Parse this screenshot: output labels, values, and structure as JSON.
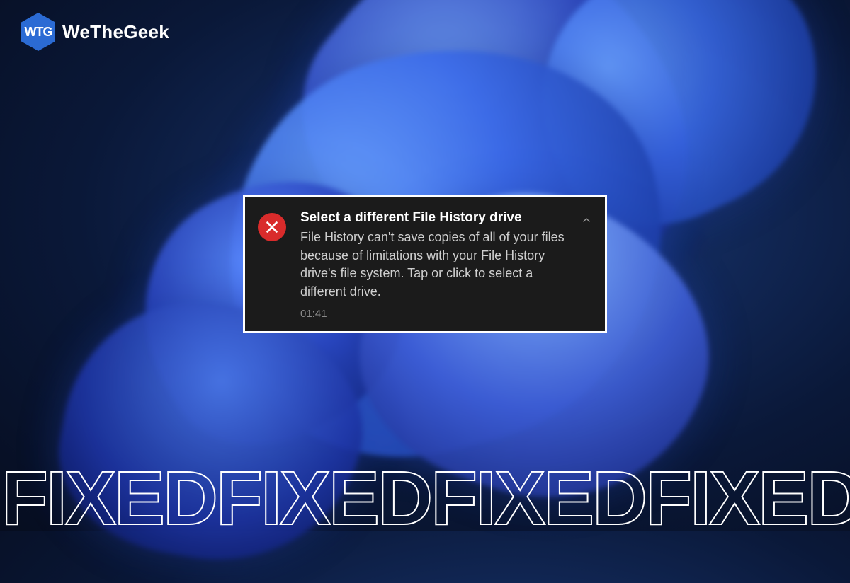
{
  "watermark": {
    "logo_text": "WTG",
    "brand": "WeTheGeek"
  },
  "notification": {
    "title": "Select a different File History drive",
    "body": "File History can't save copies of all of your files because of limitations with your File History drive's file system. Tap or click to select a different drive.",
    "time": "01:41",
    "icon": "error-x-icon",
    "chevron": "chevron-up-icon"
  },
  "banner": {
    "word": "FIXED"
  },
  "colors": {
    "error": "#d92b2b",
    "toast_bg": "#1b1b1b",
    "accent": "#2b6bd4"
  }
}
